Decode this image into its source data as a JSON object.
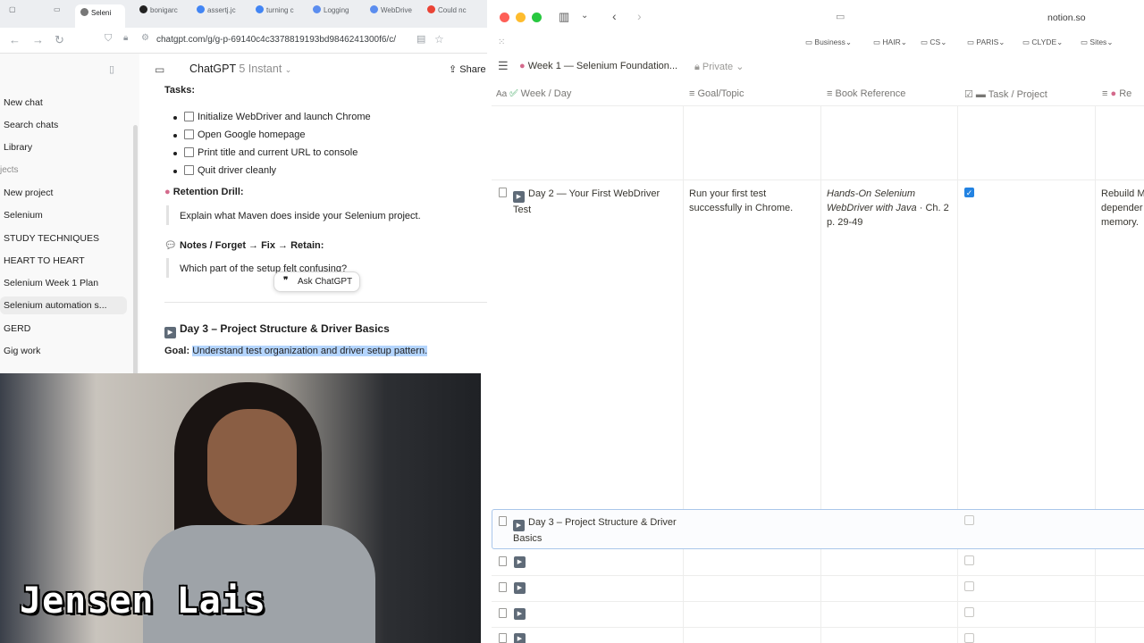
{
  "browser_left": {
    "tabs": [
      {
        "label": "Seleni"
      },
      {
        "label": "bonigarc"
      },
      {
        "label": "assertj.jc"
      },
      {
        "label": "turning c"
      },
      {
        "label": "Logging"
      },
      {
        "label": "WebDrive"
      },
      {
        "label": "Could nc"
      }
    ],
    "url": "chatgpt.com/g/g-p-69140c4c3378819193bd9846241300f6/c/"
  },
  "sidebar": {
    "items": [
      {
        "label": "New chat"
      },
      {
        "label": "Search chats"
      },
      {
        "label": "Library"
      },
      {
        "label": "jects"
      },
      {
        "label": "New project"
      },
      {
        "label": "Selenium"
      },
      {
        "label": "STUDY TECHNIQUES"
      },
      {
        "label": "HEART TO HEART"
      },
      {
        "label": "Selenium Week 1 Plan"
      },
      {
        "label": "Selenium automation s..."
      },
      {
        "label": "GERD"
      },
      {
        "label": "Gig work"
      }
    ]
  },
  "chat": {
    "title": "ChatGPT",
    "model": "5 Instant",
    "share_label": "Share",
    "tasks_heading": "Tasks:",
    "tasks": [
      "Initialize WebDriver and launch Chrome",
      "Open Google homepage",
      "Print title and current URL to console",
      "Quit driver cleanly"
    ],
    "retention_heading": "Retention Drill:",
    "retention_text": "Explain what Maven does inside your Selenium project.",
    "notes_heading": "Notes / Forget → Fix → Retain:",
    "notes_text": "Which part of the setup felt confusing?",
    "ask_label": "Ask ChatGPT",
    "day3_heading": "Day 3 – Project Structure & Driver Basics",
    "goal_label": "Goal:",
    "goal_text": "Understand test organization and driver setup pattern."
  },
  "webcam": {
    "name_overlay": "Jensen Lais"
  },
  "notion": {
    "url": "notion.so",
    "bookmarks": [
      "Business",
      "HAIR",
      "CS",
      "PARIS",
      "CLYDE",
      "Sites"
    ],
    "page_title": "Week 1 — Selenium Foundation...",
    "privacy": "Private",
    "columns": [
      {
        "label": "Week / Day"
      },
      {
        "label": "Goal/Topic"
      },
      {
        "label": "Book Reference"
      },
      {
        "label": "Task / Project"
      },
      {
        "label": "Re"
      }
    ],
    "rows": [
      {
        "day": "Day 2 — Your First WebDriver Test",
        "goal": "Run your first test successfully in Chrome.",
        "book_title": "Hands-On Selenium WebDriver with Java",
        "book_ref": "· Ch. 2 p. 29-49",
        "task_done": true,
        "extra": "Rebuild M depender memory."
      },
      {
        "day": "Day 3 – Project Structure & Driver Basics",
        "task_done": false
      }
    ]
  },
  "colors": {
    "checkbox_accent": "#2383e2",
    "highlight": "#b4d5fe",
    "selected_row_border": "#a9c6ea"
  }
}
